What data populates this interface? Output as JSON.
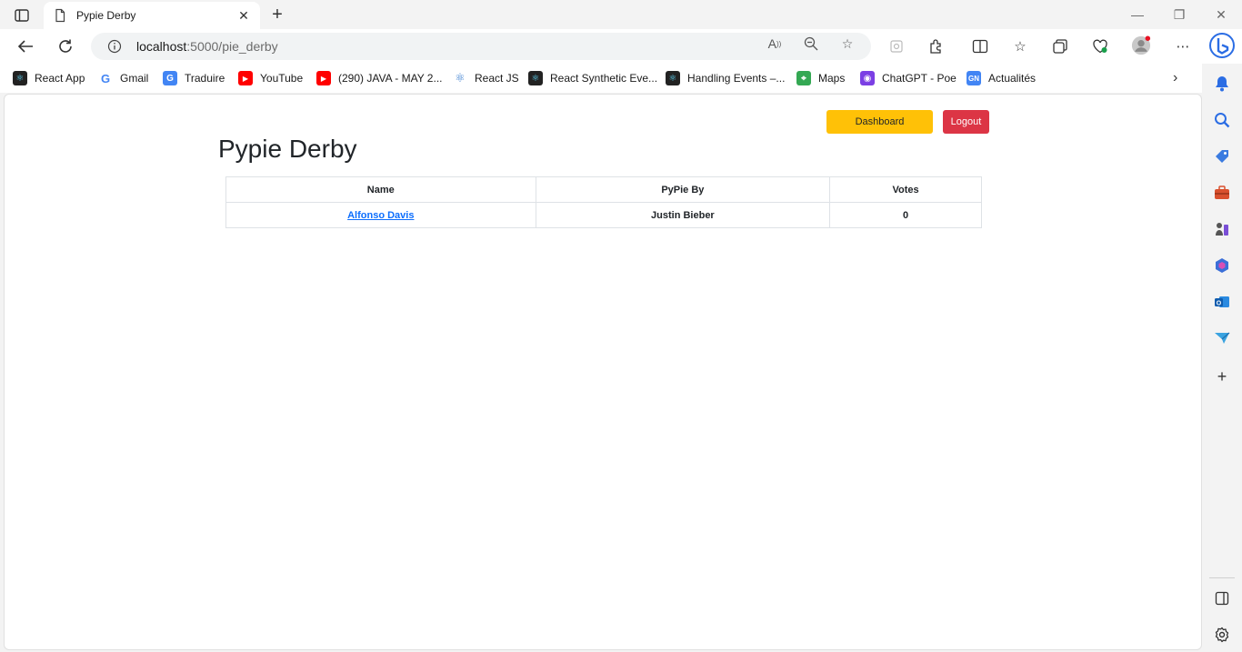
{
  "browser": {
    "tab": {
      "title": "Pypie Derby"
    },
    "url": {
      "host": "localhost",
      "path": ":5000/pie_derby"
    },
    "bookmarks": [
      {
        "label": "React App",
        "icon": "react-icon",
        "color": "#222222"
      },
      {
        "label": "Gmail",
        "icon": "google-icon",
        "color": "#ffffff"
      },
      {
        "label": "Traduire",
        "icon": "translate-icon",
        "color": "#4285f4"
      },
      {
        "label": "YouTube",
        "icon": "youtube-icon",
        "color": "#ff0000"
      },
      {
        "label": "(290) JAVA - MAY 2...",
        "icon": "youtube-icon",
        "color": "#ff0000"
      },
      {
        "label": "React JS",
        "icon": "react-icon",
        "color": "#ffffff"
      },
      {
        "label": "React Synthetic Eve...",
        "icon": "react-icon",
        "color": "#222222"
      },
      {
        "label": "Handling Events –...",
        "icon": "react-icon",
        "color": "#222222"
      },
      {
        "label": "Maps",
        "icon": "maps-icon",
        "color": "#34a853"
      },
      {
        "label": "ChatGPT - Poe",
        "icon": "poe-icon",
        "color": "#7b3fe4"
      },
      {
        "label": "Actualités",
        "icon": "news-icon",
        "color": "#4285f4"
      }
    ]
  },
  "page": {
    "title": "Pypie Derby",
    "buttons": {
      "dashboard": "Dashboard",
      "logout": "Logout"
    },
    "table": {
      "headers": [
        "Name",
        "PyPie By",
        "Votes"
      ],
      "rows": [
        {
          "name": "Alfonso Davis",
          "by": "Justin Bieber",
          "votes": "0"
        }
      ]
    }
  },
  "colors": {
    "dashboard_button": "#ffc107",
    "logout_button": "#dc3545",
    "link": "#0d6efd"
  }
}
